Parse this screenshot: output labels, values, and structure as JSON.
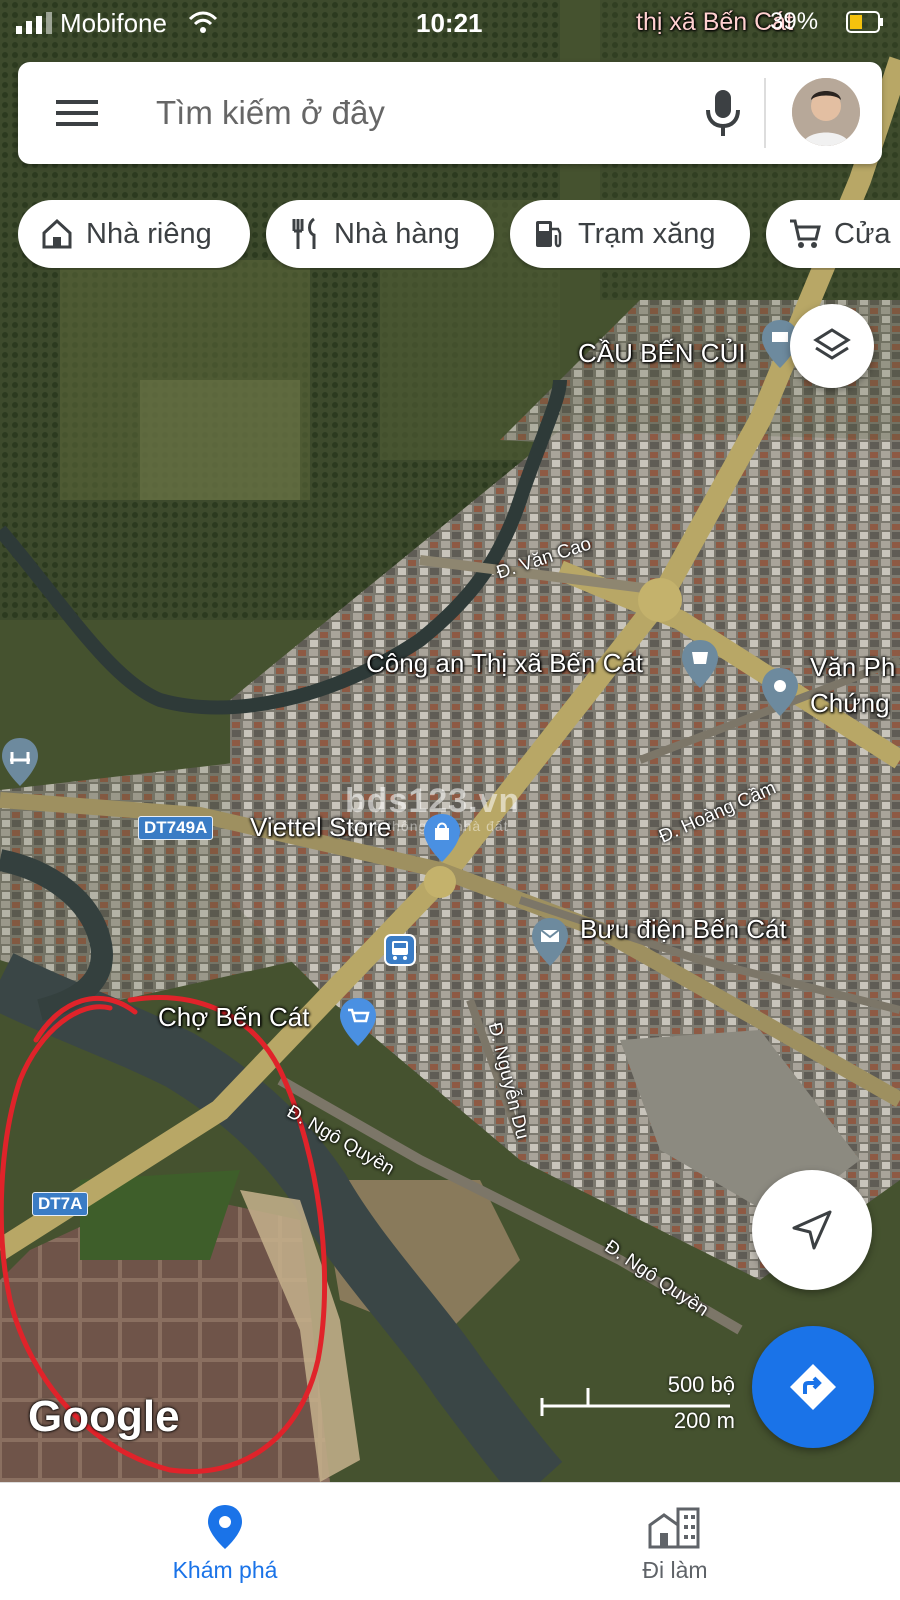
{
  "status_bar": {
    "carrier": "Mobifone",
    "time": "10:21",
    "battery": "39%"
  },
  "search": {
    "placeholder": "Tìm kiếm ở đây"
  },
  "chips": [
    {
      "label": "Nhà riêng",
      "icon": "home-icon"
    },
    {
      "label": "Nhà hàng",
      "icon": "restaurant-icon"
    },
    {
      "label": "Trạm xăng",
      "icon": "gas-station-icon"
    },
    {
      "label": "Cửa",
      "icon": "cart-icon"
    }
  ],
  "map": {
    "labels": {
      "cau_ben_cui": "CẦU BẾN CỦI",
      "cong_an": "Công an Thị xã Bến Cát",
      "van_phong_1": "Văn Ph",
      "van_phong_2": "Chứng",
      "viettel": "Viettel Store",
      "buu_dien": "Bưu điện Bến Cát",
      "cho_ben_cat": "Chợ Bến Cát",
      "top_right_text": "thị xã Bến Cát"
    },
    "streets": {
      "van_cao": "Đ. Văn Cao",
      "hoang_cam": "Đ. Hoàng Cầm",
      "nguyen_du": "Đ. Nguyễn Du",
      "ngo_quyen_1": "Đ. Ngô Quyền",
      "ngo_quyen_2": "Đ. Ngô Quyền"
    },
    "route_badges": {
      "dt749a": "DT749A",
      "dt7a": "DT7A"
    },
    "watermark": "bds123.vn",
    "watermark_sub": "kênh thông tin nhà đất",
    "logo": "Google",
    "scale": {
      "imperial": "500 bộ",
      "metric": "200 m"
    }
  },
  "bottom_nav": {
    "explore": "Khám phá",
    "commute": "Đi làm"
  },
  "colors": {
    "accent": "#1a73e8",
    "annotation": "#e0232a",
    "road": "#b8a766"
  }
}
